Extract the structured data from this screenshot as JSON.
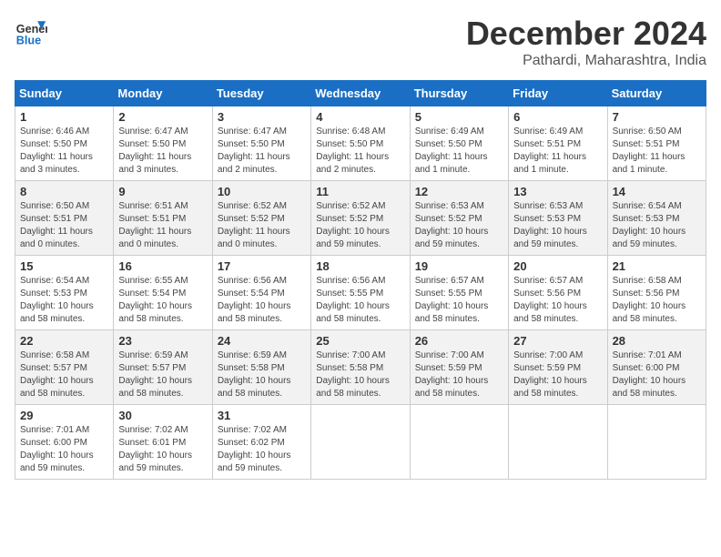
{
  "header": {
    "logo_line1": "General",
    "logo_line2": "Blue",
    "month": "December 2024",
    "location": "Pathardi, Maharashtra, India"
  },
  "days_of_week": [
    "Sunday",
    "Monday",
    "Tuesday",
    "Wednesday",
    "Thursday",
    "Friday",
    "Saturday"
  ],
  "weeks": [
    [
      {
        "day": 1,
        "sunrise": "6:46 AM",
        "sunset": "5:50 PM",
        "daylight": "11 hours and 3 minutes."
      },
      {
        "day": 2,
        "sunrise": "6:47 AM",
        "sunset": "5:50 PM",
        "daylight": "11 hours and 3 minutes."
      },
      {
        "day": 3,
        "sunrise": "6:47 AM",
        "sunset": "5:50 PM",
        "daylight": "11 hours and 2 minutes."
      },
      {
        "day": 4,
        "sunrise": "6:48 AM",
        "sunset": "5:50 PM",
        "daylight": "11 hours and 2 minutes."
      },
      {
        "day": 5,
        "sunrise": "6:49 AM",
        "sunset": "5:50 PM",
        "daylight": "11 hours and 1 minute."
      },
      {
        "day": 6,
        "sunrise": "6:49 AM",
        "sunset": "5:51 PM",
        "daylight": "11 hours and 1 minute."
      },
      {
        "day": 7,
        "sunrise": "6:50 AM",
        "sunset": "5:51 PM",
        "daylight": "11 hours and 1 minute."
      }
    ],
    [
      {
        "day": 8,
        "sunrise": "6:50 AM",
        "sunset": "5:51 PM",
        "daylight": "11 hours and 0 minutes."
      },
      {
        "day": 9,
        "sunrise": "6:51 AM",
        "sunset": "5:51 PM",
        "daylight": "11 hours and 0 minutes."
      },
      {
        "day": 10,
        "sunrise": "6:52 AM",
        "sunset": "5:52 PM",
        "daylight": "11 hours and 0 minutes."
      },
      {
        "day": 11,
        "sunrise": "6:52 AM",
        "sunset": "5:52 PM",
        "daylight": "10 hours and 59 minutes."
      },
      {
        "day": 12,
        "sunrise": "6:53 AM",
        "sunset": "5:52 PM",
        "daylight": "10 hours and 59 minutes."
      },
      {
        "day": 13,
        "sunrise": "6:53 AM",
        "sunset": "5:53 PM",
        "daylight": "10 hours and 59 minutes."
      },
      {
        "day": 14,
        "sunrise": "6:54 AM",
        "sunset": "5:53 PM",
        "daylight": "10 hours and 59 minutes."
      }
    ],
    [
      {
        "day": 15,
        "sunrise": "6:54 AM",
        "sunset": "5:53 PM",
        "daylight": "10 hours and 58 minutes."
      },
      {
        "day": 16,
        "sunrise": "6:55 AM",
        "sunset": "5:54 PM",
        "daylight": "10 hours and 58 minutes."
      },
      {
        "day": 17,
        "sunrise": "6:56 AM",
        "sunset": "5:54 PM",
        "daylight": "10 hours and 58 minutes."
      },
      {
        "day": 18,
        "sunrise": "6:56 AM",
        "sunset": "5:55 PM",
        "daylight": "10 hours and 58 minutes."
      },
      {
        "day": 19,
        "sunrise": "6:57 AM",
        "sunset": "5:55 PM",
        "daylight": "10 hours and 58 minutes."
      },
      {
        "day": 20,
        "sunrise": "6:57 AM",
        "sunset": "5:56 PM",
        "daylight": "10 hours and 58 minutes."
      },
      {
        "day": 21,
        "sunrise": "6:58 AM",
        "sunset": "5:56 PM",
        "daylight": "10 hours and 58 minutes."
      }
    ],
    [
      {
        "day": 22,
        "sunrise": "6:58 AM",
        "sunset": "5:57 PM",
        "daylight": "10 hours and 58 minutes."
      },
      {
        "day": 23,
        "sunrise": "6:59 AM",
        "sunset": "5:57 PM",
        "daylight": "10 hours and 58 minutes."
      },
      {
        "day": 24,
        "sunrise": "6:59 AM",
        "sunset": "5:58 PM",
        "daylight": "10 hours and 58 minutes."
      },
      {
        "day": 25,
        "sunrise": "7:00 AM",
        "sunset": "5:58 PM",
        "daylight": "10 hours and 58 minutes."
      },
      {
        "day": 26,
        "sunrise": "7:00 AM",
        "sunset": "5:59 PM",
        "daylight": "10 hours and 58 minutes."
      },
      {
        "day": 27,
        "sunrise": "7:00 AM",
        "sunset": "5:59 PM",
        "daylight": "10 hours and 58 minutes."
      },
      {
        "day": 28,
        "sunrise": "7:01 AM",
        "sunset": "6:00 PM",
        "daylight": "10 hours and 58 minutes."
      }
    ],
    [
      {
        "day": 29,
        "sunrise": "7:01 AM",
        "sunset": "6:00 PM",
        "daylight": "10 hours and 59 minutes."
      },
      {
        "day": 30,
        "sunrise": "7:02 AM",
        "sunset": "6:01 PM",
        "daylight": "10 hours and 59 minutes."
      },
      {
        "day": 31,
        "sunrise": "7:02 AM",
        "sunset": "6:02 PM",
        "daylight": "10 hours and 59 minutes."
      },
      null,
      null,
      null,
      null
    ]
  ]
}
